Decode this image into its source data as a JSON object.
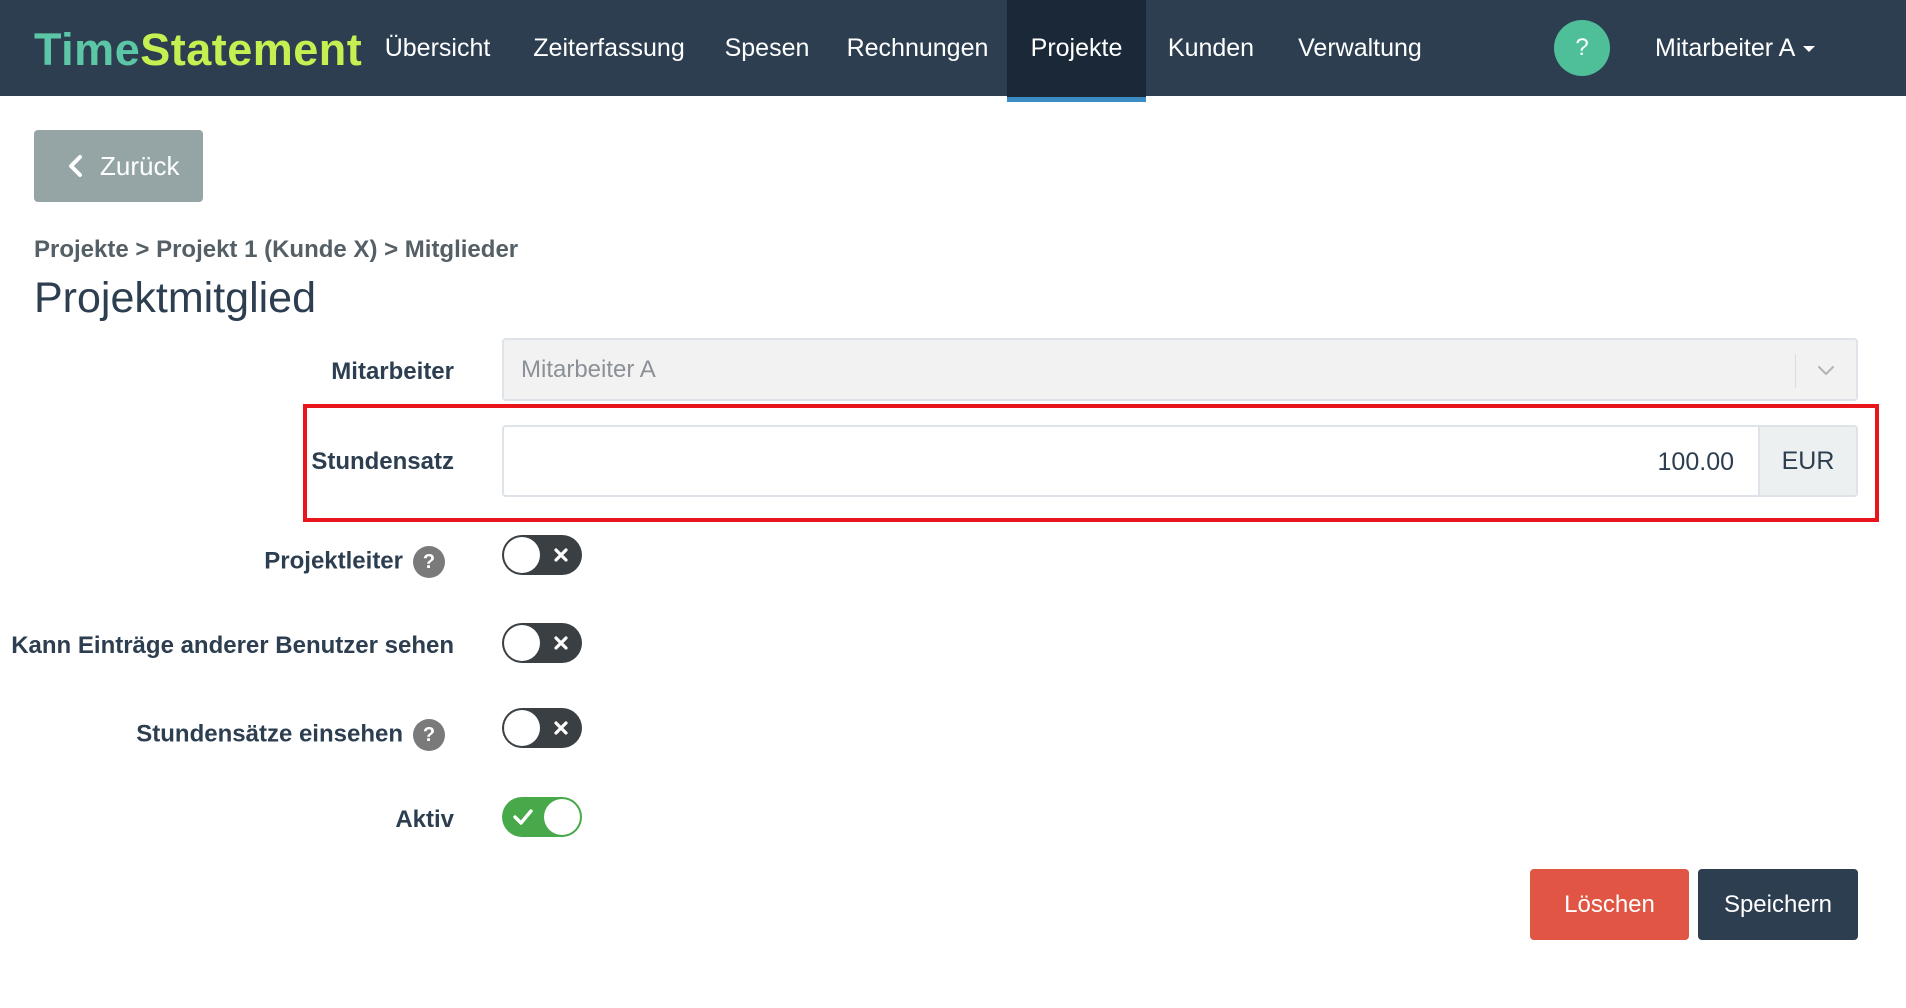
{
  "brand": {
    "part1": "Time",
    "part2": "Statement",
    "color1": "#5cc7a6",
    "color2": "#c6f051"
  },
  "nav": {
    "items": [
      "Übersicht",
      "Zeiterfassung",
      "Spesen",
      "Rechnungen",
      "Projekte",
      "Kunden",
      "Verwaltung"
    ],
    "active": "Projekte",
    "help": "?",
    "user": "Mitarbeiter A"
  },
  "back_button": {
    "label": "Zurück"
  },
  "breadcrumb": "Projekte > Projekt 1 (Kunde X) > Mitglieder",
  "page_title": "Projektmitglied",
  "form": {
    "employee": {
      "label": "Mitarbeiter",
      "value": "Mitarbeiter A"
    },
    "rate": {
      "label": "Stundensatz",
      "value": "100.00",
      "currency": "EUR"
    },
    "project_lead": {
      "label": "Projektleiter",
      "help": "?",
      "on": false
    },
    "see_others": {
      "label": "Kann Einträge anderer Benutzer sehen",
      "on": false
    },
    "see_rates": {
      "label": "Stundensätze einsehen",
      "help": "?",
      "on": false
    },
    "active": {
      "label": "Aktiv",
      "on": true
    }
  },
  "actions": {
    "delete": "Löschen",
    "save": "Speichern"
  },
  "colors": {
    "navbar": "#2c3e50",
    "highlight": "#e8161b",
    "delete": "#e05543",
    "toggle_on": "#47a94a",
    "help_circle": "#4fbf9a"
  }
}
